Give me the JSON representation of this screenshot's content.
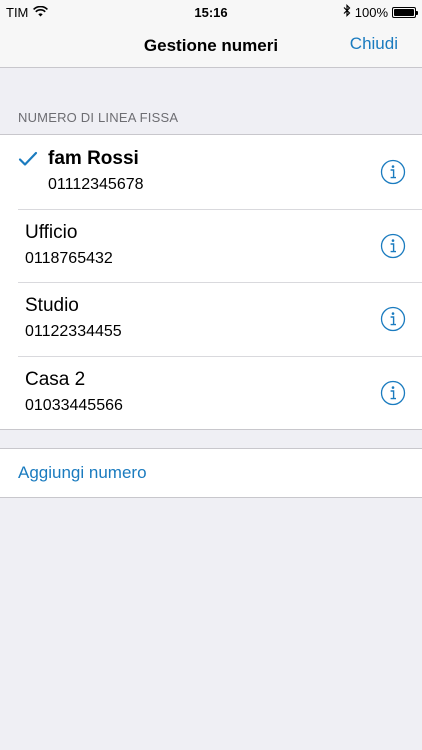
{
  "status_bar": {
    "carrier": "TIM",
    "time": "15:16",
    "battery_percent": "100%",
    "battery_level": 1.0,
    "icons": [
      "wifi-icon",
      "bluetooth-icon",
      "battery-icon"
    ]
  },
  "nav": {
    "title": "Gestione numeri",
    "close_label": "Chiudi"
  },
  "section": {
    "header": "NUMERO DI LINEA FISSA"
  },
  "numbers": [
    {
      "name": "fam Rossi",
      "number": "01112345678",
      "selected": true
    },
    {
      "name": "Ufficio",
      "number": "0118765432",
      "selected": false
    },
    {
      "name": "Studio",
      "number": "01122334455",
      "selected": false
    },
    {
      "name": "Casa 2",
      "number": "01033445566",
      "selected": false
    }
  ],
  "add": {
    "label": "Aggiungi numero"
  },
  "colors": {
    "accent": "#1a7bbf",
    "background": "#efeff4"
  }
}
